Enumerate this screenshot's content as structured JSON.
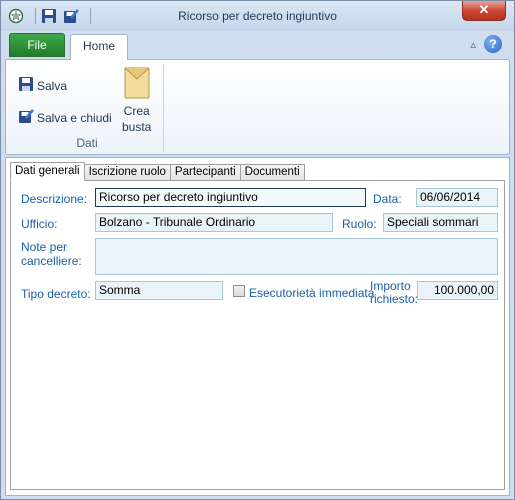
{
  "window": {
    "title": "Ricorso per decreto ingiuntivo",
    "close_label": "✕"
  },
  "ribbon": {
    "tabs": {
      "file": "File",
      "home": "Home"
    },
    "buttons": {
      "salva": "Salva",
      "salva_chiudi": "Salva e chiudi",
      "crea_busta_1": "Crea",
      "crea_busta_2": "busta"
    },
    "group_label": "Dati"
  },
  "content_tabs": [
    "Dati generali",
    "Iscrizione ruolo",
    "Partecipanti",
    "Documenti"
  ],
  "form": {
    "descrizione": {
      "label": "Descrizione:",
      "value": "Ricorso per decreto ingiuntivo"
    },
    "data": {
      "label": "Data:",
      "value": "06/06/2014"
    },
    "ufficio": {
      "label": "Ufficio:",
      "value": "Bolzano - Tribunale Ordinario"
    },
    "ruolo": {
      "label": "Ruolo:",
      "value": "Speciali sommari"
    },
    "note": {
      "label_1": "Note per",
      "label_2": "cancelliere:",
      "value": ""
    },
    "tipo_decreto": {
      "label": "Tipo decreto:",
      "value": "Somma"
    },
    "esecutorieta": {
      "label": "Esecutorietà immediata",
      "checked": false
    },
    "importo": {
      "label_1": "Importo",
      "label_2": "richiesto:",
      "value": "100.000,00"
    }
  },
  "colors": {
    "label_blue": "#1a5fa8",
    "file_tab_green": "#2a8c35",
    "field_bg": "#eaf3f8"
  }
}
